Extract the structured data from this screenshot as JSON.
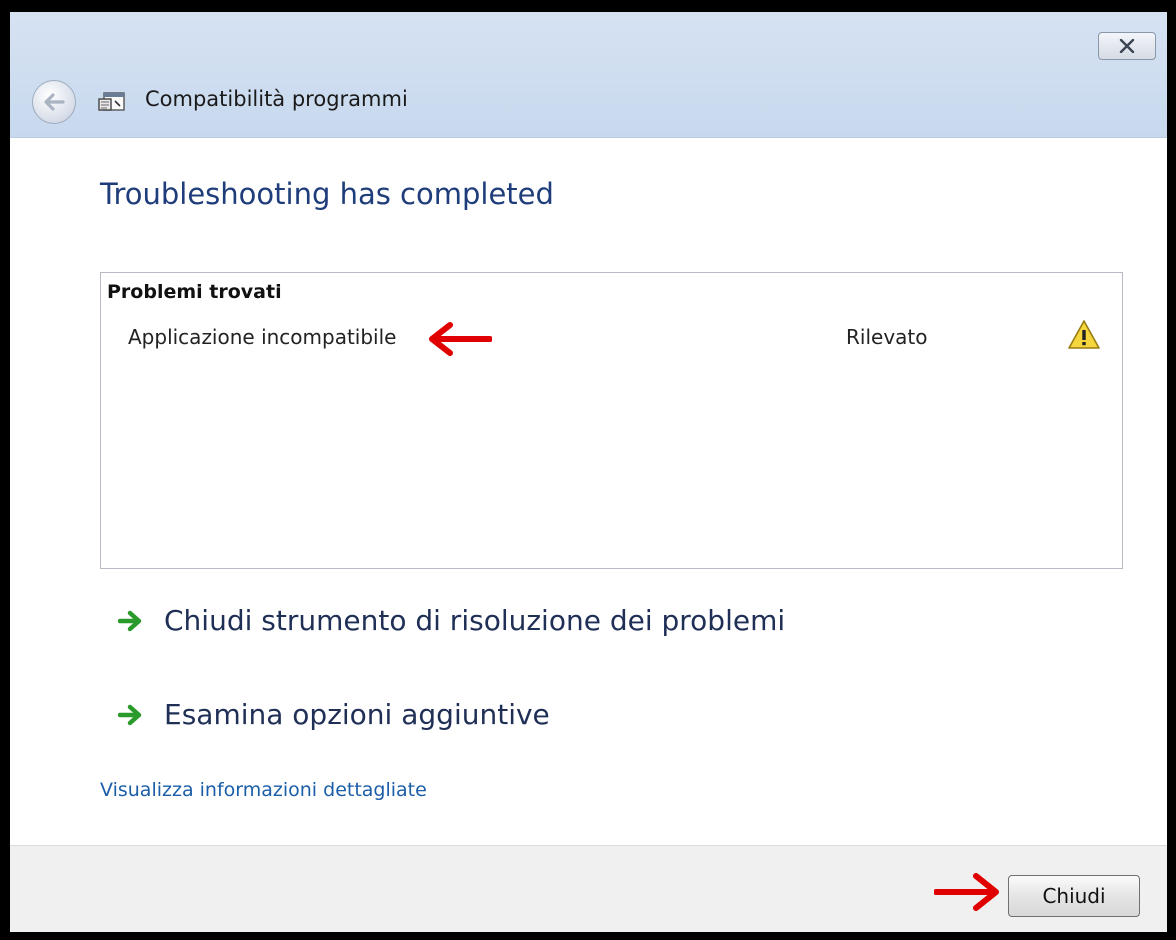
{
  "window": {
    "title": "Compatibilità programmi",
    "close_icon": "close-x-icon",
    "back_icon": "back-arrow-icon",
    "app_icon": "program-compatibility-icon"
  },
  "main": {
    "heading": "Troubleshooting has completed",
    "problems": {
      "header": "Problemi trovati",
      "items": [
        {
          "name": "Applicazione incompatibile",
          "status": "Rilevato",
          "status_icon": "warning-icon"
        }
      ]
    },
    "commands": [
      {
        "label": "Chiudi strumento di risoluzione dei problemi",
        "icon": "green-arrow-icon"
      },
      {
        "label": "Esamina opzioni aggiuntive",
        "icon": "green-arrow-icon"
      }
    ],
    "details_link": "Visualizza informazioni dettagliate"
  },
  "footer": {
    "close_button": "Chiudi"
  },
  "annotations": {
    "arrow_color": "#e00000"
  }
}
